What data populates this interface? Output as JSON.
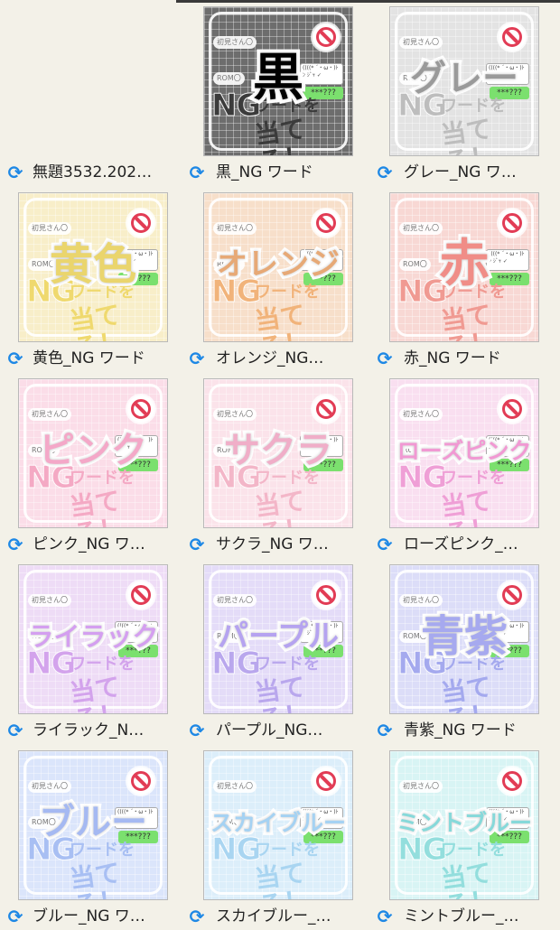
{
  "items": [
    {
      "name": "無題3532.202…",
      "title": "",
      "box": "",
      "accent": "#ffffff",
      "text_color": "#444444",
      "empty": true
    },
    {
      "name": "黒_NG ワード",
      "title": "黒",
      "box": "#6d6d6d",
      "accent": "#3b3b3b",
      "text_color": "#000000"
    },
    {
      "name": "グレー_NG ワ…",
      "title": "グレー",
      "box": "#e3e3e3",
      "accent": "#bdbdbd",
      "text_color": "#9a9a9a"
    },
    {
      "name": "黄色_NG ワード",
      "title": "黄色",
      "box": "#f8eec9",
      "accent": "#efd96e",
      "text_color": "#ead56d"
    },
    {
      "name": "オレンジ_NG…",
      "title": "オレンジ",
      "box": "#f7dfca",
      "accent": "#f1b37a",
      "text_color": "#e7a976"
    },
    {
      "name": "赤_NG ワード",
      "title": "赤",
      "box": "#f8d8d4",
      "accent": "#f09a92",
      "text_color": "#f08d87"
    },
    {
      "name": "ピンク_NG ワ…",
      "title": "ピンク",
      "box": "#fbdde8",
      "accent": "#f4a9c4",
      "text_color": "#f4a8c8"
    },
    {
      "name": "サクラ_NG ワ…",
      "title": "サクラ",
      "box": "#fbe3ea",
      "accent": "#f3b6c8",
      "text_color": "#f0aec8"
    },
    {
      "name": "ローズピンク_…",
      "title": "ローズピンク",
      "box": "#f9dff0",
      "accent": "#ef9fd6",
      "text_color": "#f199d3"
    },
    {
      "name": "ライラック_N…",
      "title": "ライラック",
      "box": "#eedcf6",
      "accent": "#d3a3ec",
      "text_color": "#d49ff0"
    },
    {
      "name": "パープル_NG…",
      "title": "パープル",
      "box": "#e4dcf8",
      "accent": "#b9a7ed",
      "text_color": "#b5a3f0"
    },
    {
      "name": "青紫_NG ワード",
      "title": "青紫",
      "box": "#dcddf8",
      "accent": "#a4a9ee",
      "text_color": "#a6a9ef"
    },
    {
      "name": "ブルー_NG ワ…",
      "title": "ブルー",
      "box": "#dbe5fb",
      "accent": "#a8bff3",
      "text_color": "#a5b9f2"
    },
    {
      "name": "スカイブルー_…",
      "title": "スカイブルー",
      "box": "#dceefa",
      "accent": "#a9d5f1",
      "text_color": "#a5d2f3"
    },
    {
      "name": "ミントブルー_…",
      "title": "ミントブルー",
      "box": "#d8f4f4",
      "accent": "#93dedd",
      "text_color": "#86d9da"
    }
  ],
  "common": {
    "bubble1": "初見さん〇",
    "bubble2": "ROM〇",
    "chat": "((((* ´・ω・)ﾄﾝ ｼﾞｬ ✓",
    "q": "***???",
    "ng": "NG",
    "ngsub": "ワードを",
    "ateru": "当てろ！"
  },
  "colors": {
    "sync": "#1e88e5",
    "background": "#f3f1e8"
  }
}
